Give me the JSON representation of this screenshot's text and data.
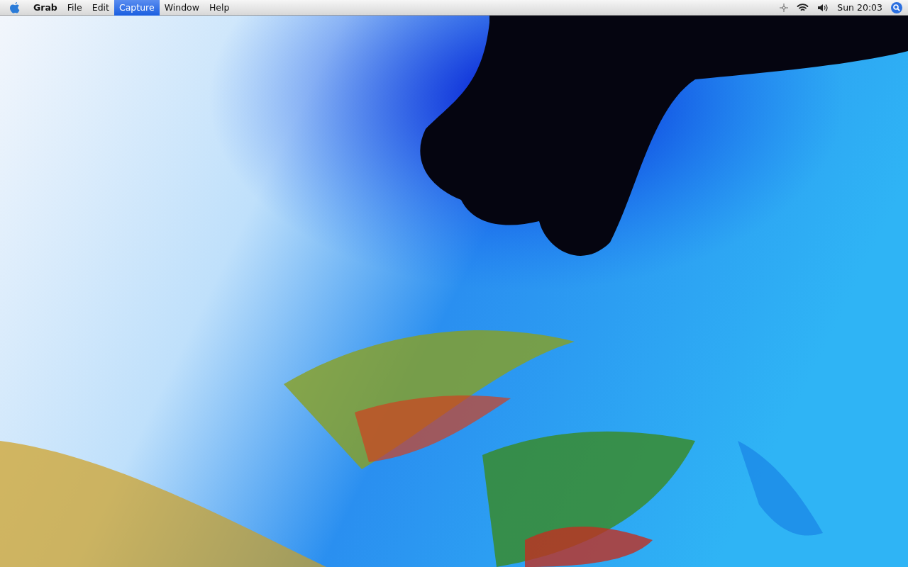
{
  "menu_bar": {
    "items": [
      {
        "label": "Grab",
        "kind": "app",
        "selected": false
      },
      {
        "label": "File",
        "kind": "menu",
        "selected": false
      },
      {
        "label": "Edit",
        "kind": "menu",
        "selected": false
      },
      {
        "label": "Capture",
        "kind": "menu",
        "selected": true
      },
      {
        "label": "Window",
        "kind": "menu",
        "selected": false
      },
      {
        "label": "Help",
        "kind": "menu",
        "selected": false
      }
    ],
    "clock": "Sun 20:03"
  }
}
